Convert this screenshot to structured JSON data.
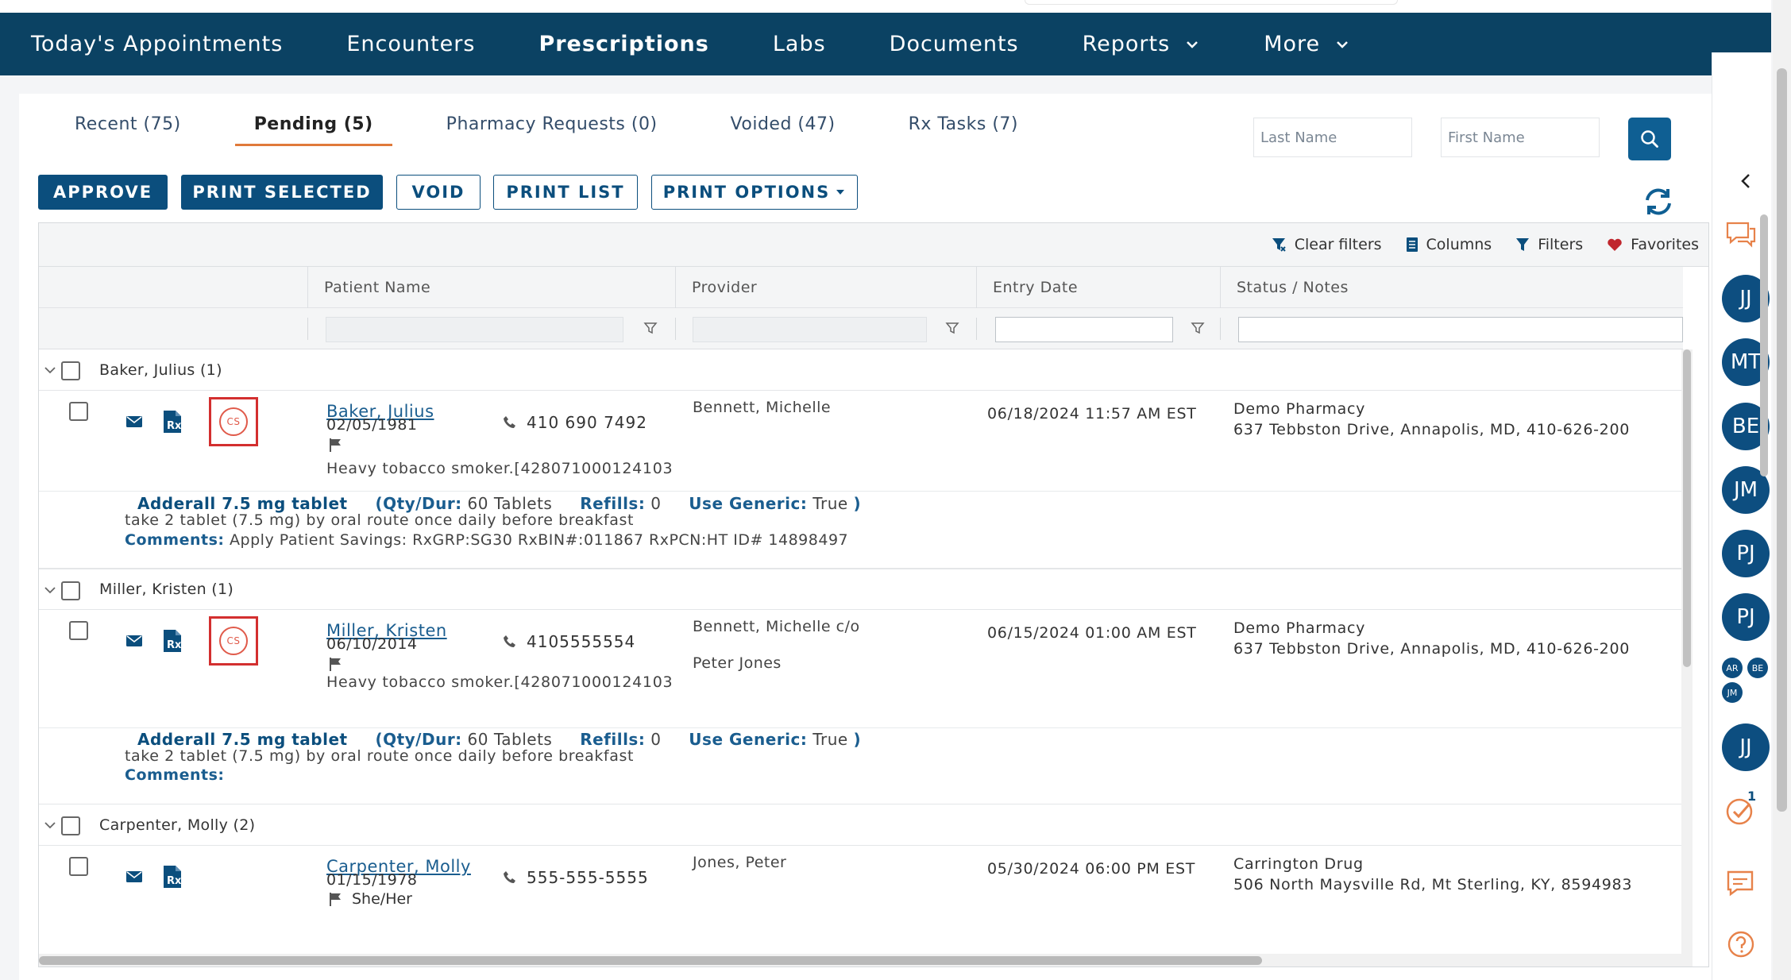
{
  "nav": {
    "items": [
      {
        "label": "Today's Appointments"
      },
      {
        "label": "Encounters"
      },
      {
        "label": "Prescriptions",
        "active": true
      },
      {
        "label": "Labs"
      },
      {
        "label": "Documents"
      },
      {
        "label": "Reports",
        "dropdown": true
      },
      {
        "label": "More",
        "dropdown": true
      }
    ]
  },
  "tabs": [
    {
      "label": "Recent (75)"
    },
    {
      "label": "Pending (5)",
      "active": true
    },
    {
      "label": "Pharmacy Requests (0)"
    },
    {
      "label": "Voided (47)"
    },
    {
      "label": "Rx Tasks (7)"
    }
  ],
  "search": {
    "last_name_placeholder": "Last Name",
    "first_name_placeholder": "First Name",
    "icon": "search-icon"
  },
  "actions": {
    "approve": "APPROVE",
    "print_selected": "PRINT SELECTED",
    "void": "VOID",
    "print_list": "PRINT LIST",
    "print_options": "PRINT OPTIONS"
  },
  "toolbar": {
    "clear_filters": "Clear filters",
    "columns": "Columns",
    "filters": "Filters",
    "favorites": "Favorites"
  },
  "columns": {
    "patient_name": "Patient Name",
    "provider": "Provider",
    "entry_date": "Entry Date",
    "status_notes": "Status / Notes"
  },
  "groups": [
    {
      "label": "Baker, Julius (1)",
      "patient": "Baker, Julius",
      "dob": "02/05/1981",
      "phone": "410 690 7492",
      "note": "Heavy tobacco smoker.[428071000124103",
      "provider": "Bennett, Michelle",
      "provider2": "",
      "entry_date": "06/18/2024 11:57 AM EST",
      "pharmacy": "Demo Pharmacy",
      "pharmacy_address": "637 Tebbston Drive, Annapolis, MD, 410-626-200",
      "controlled": true,
      "cs_label": "CS",
      "drug": "Adderall 7.5 mg tablet",
      "qty_label": "Qty/Dur:",
      "qty": "60 Tablets",
      "refills_label": "Refills:",
      "refills": "0",
      "generic_label": "Use Generic:",
      "generic": "True",
      "sig": "take 2 tablet (7.5 mg) by oral route once daily before breakfast",
      "comments_label": "Comments:",
      "comments": "Apply Patient Savings: RxGRP:SG30 RxBIN#:011867 RxPCN:HT ID# 14898497"
    },
    {
      "label": "Miller, Kristen (1)",
      "patient": "Miller, Kristen",
      "dob": "06/10/2014",
      "phone": "4105555554",
      "note": "Heavy tobacco smoker.[428071000124103",
      "provider": "Bennett, Michelle c/o",
      "provider2": "Peter Jones",
      "entry_date": "06/15/2024 01:00 AM EST",
      "pharmacy": "Demo Pharmacy",
      "pharmacy_address": "637 Tebbston Drive, Annapolis, MD, 410-626-200",
      "controlled": true,
      "cs_label": "CS",
      "drug": "Adderall 7.5 mg tablet",
      "qty_label": "Qty/Dur:",
      "qty": "60 Tablets",
      "refills_label": "Refills:",
      "refills": "0",
      "generic_label": "Use Generic:",
      "generic": "True",
      "sig": "take 2 tablet (7.5 mg) by oral route once daily before breakfast",
      "comments_label": "Comments:",
      "comments": ""
    },
    {
      "label": "Carpenter, Molly (2)",
      "patient": "Carpenter, Molly",
      "dob": "01/15/1978",
      "phone": "555-555-5555",
      "pronouns": "She/Her",
      "provider": "Jones, Peter",
      "entry_date": "05/30/2024 06:00 PM EST",
      "pharmacy": "Carrington Drug",
      "pharmacy_address": "506 North Maysville Rd, Mt Sterling, KY, 8594983",
      "controlled": false
    }
  ],
  "sidebar": {
    "avatars": [
      "JJ",
      "MT",
      "BE",
      "JM",
      "PJ",
      "PJ"
    ],
    "mini_avatars": [
      "AR",
      "BE",
      "JM"
    ],
    "last_avatar": "JJ",
    "task_count": "1"
  },
  "colors": {
    "nav_bg": "#0b4263",
    "primary": "#0b4e7d",
    "accent_tab": "#e07a3a",
    "cs_border": "#d32f2f",
    "link": "#1a5d8f"
  }
}
